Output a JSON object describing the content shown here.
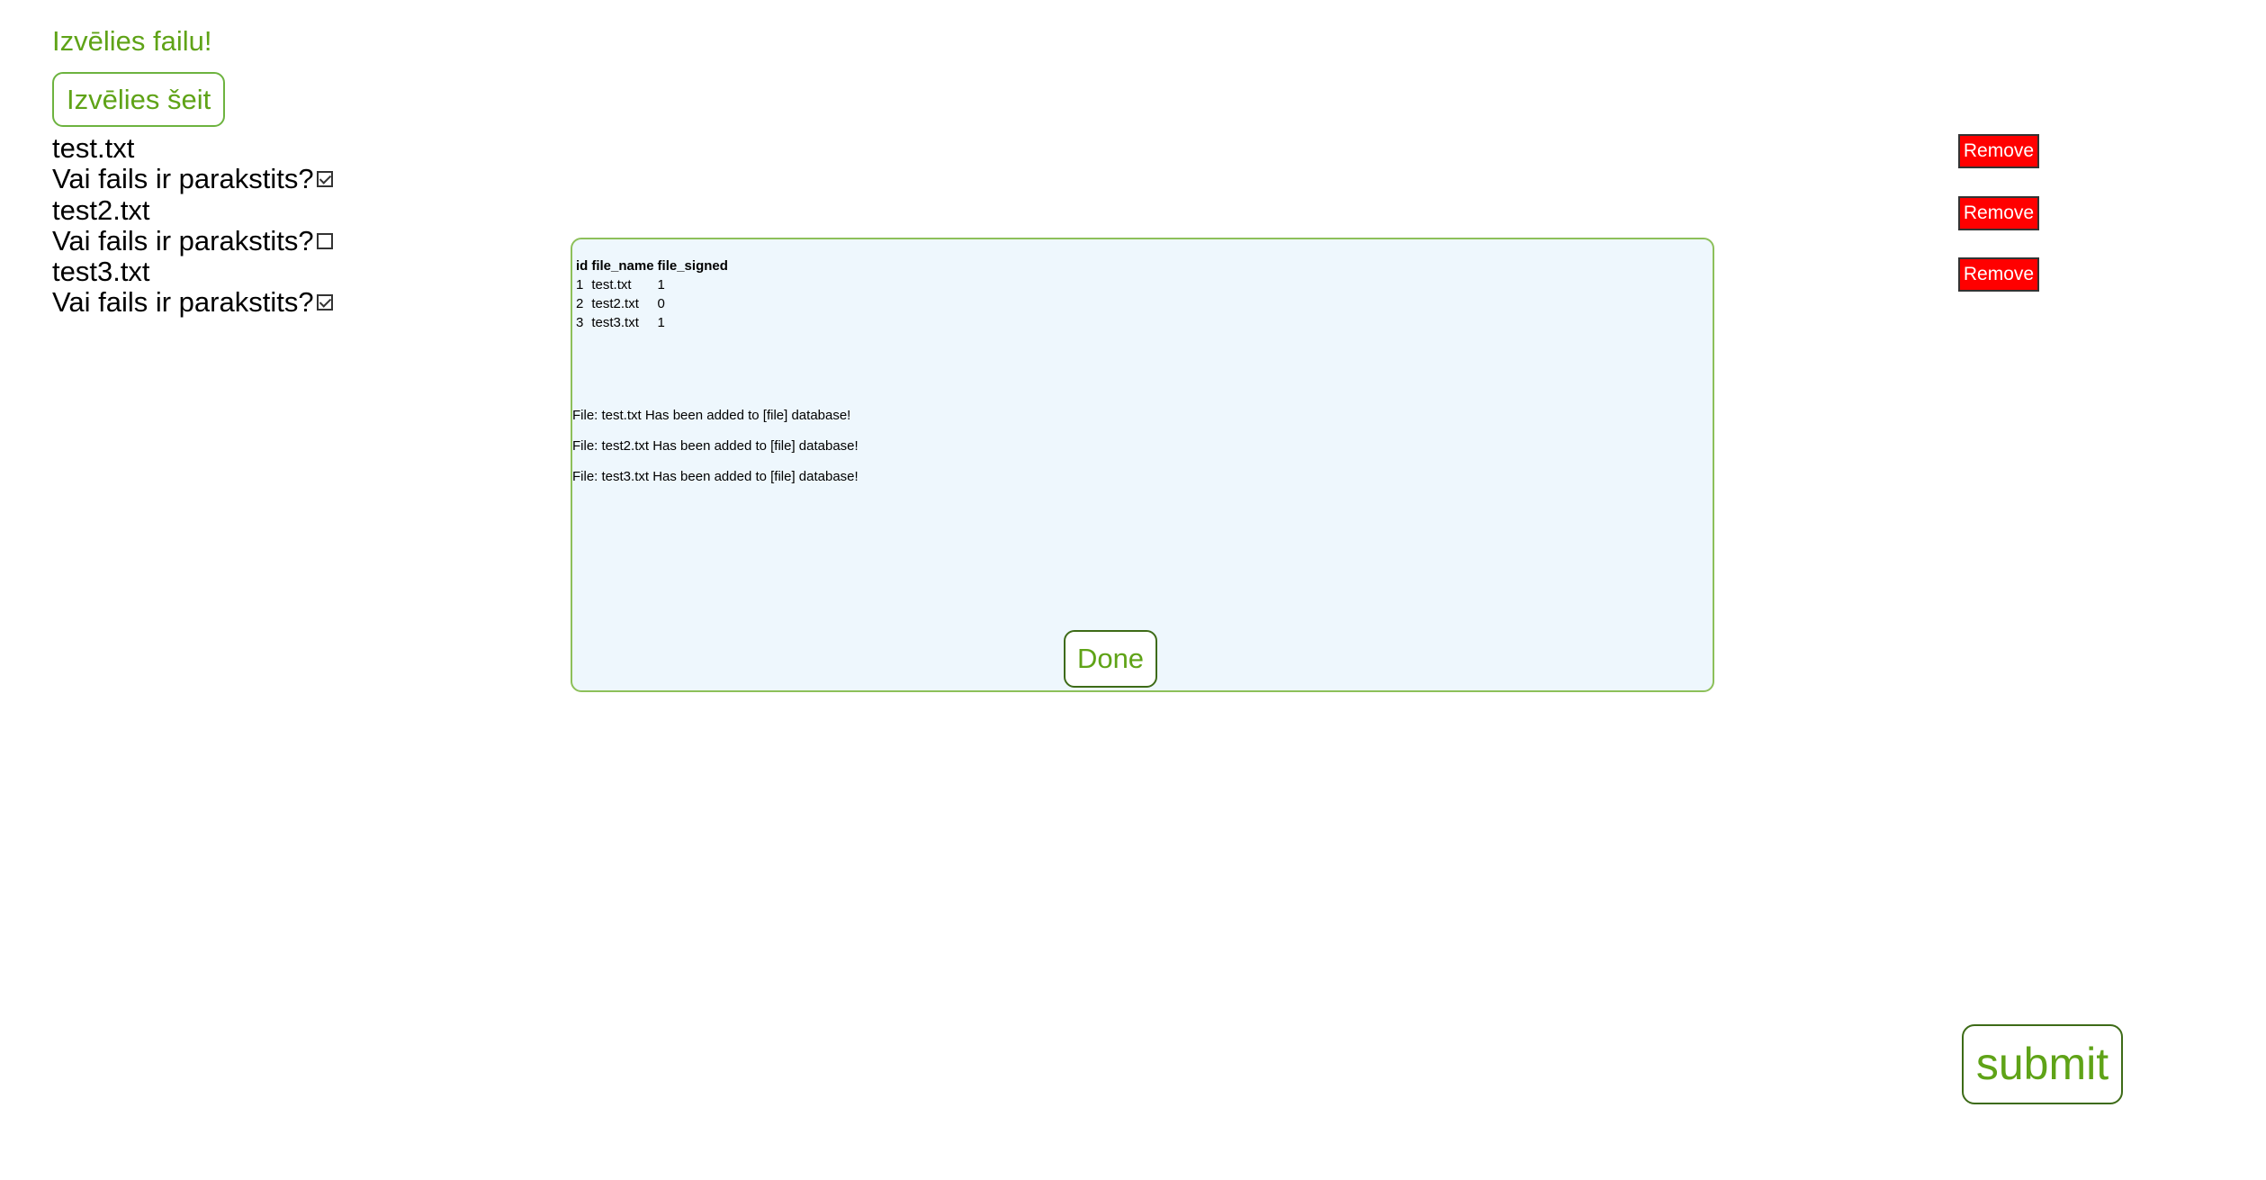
{
  "header": {
    "title": "Izvēlies failu!",
    "choose_label": "Izvēlies šeit"
  },
  "files": [
    {
      "name": "test.txt",
      "signed_question": "Vai fails ir parakstits?",
      "signed": true,
      "remove_label": "Remove"
    },
    {
      "name": "test2.txt",
      "signed_question": "Vai fails ir parakstits?",
      "signed": false,
      "remove_label": "Remove"
    },
    {
      "name": "test3.txt",
      "signed_question": "Vai fails ir parakstits?",
      "signed": true,
      "remove_label": "Remove"
    }
  ],
  "modal": {
    "table": {
      "columns": [
        "id",
        "file_name",
        "file_signed"
      ],
      "rows": [
        [
          "1",
          "test.txt",
          "1"
        ],
        [
          "2",
          "test2.txt",
          "0"
        ],
        [
          "3",
          "test3.txt",
          "1"
        ]
      ]
    },
    "messages": [
      "File: test.txt Has been added to [file] database!",
      "File: test2.txt Has been added to [file] database!",
      "File: test3.txt Has been added to [file] database!"
    ],
    "done_label": "Done"
  },
  "submit_label": "submit",
  "colors": {
    "accent_green": "#5fa317",
    "remove_red": "#ff0000",
    "modal_bg": "#eef7fd"
  }
}
